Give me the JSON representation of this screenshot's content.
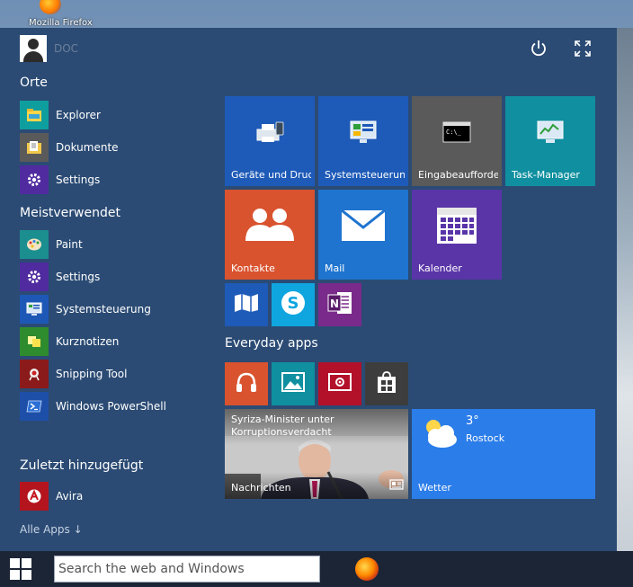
{
  "desktop": {
    "icon_label": "Mozilla Firefox"
  },
  "user": {
    "name": "DOC"
  },
  "sections": {
    "orte": "Orte",
    "meist": "Meistverwendet",
    "zuletzt": "Zuletzt hinzugefügt"
  },
  "orte_items": [
    {
      "label": "Explorer",
      "icon": "folder-icon",
      "color": "#0f9e9e"
    },
    {
      "label": "Dokumente",
      "icon": "document-icon",
      "color": "#5a5a5a"
    },
    {
      "label": "Settings",
      "icon": "gear-icon",
      "color": "#4f2b9f"
    }
  ],
  "meist_items": [
    {
      "label": "Paint",
      "icon": "palette-icon",
      "color": "#1b8f8f"
    },
    {
      "label": "Settings",
      "icon": "gear-icon",
      "color": "#4f2b9f"
    },
    {
      "label": "Systemsteuerung",
      "icon": "control-panel-icon",
      "color": "#1e58b6"
    },
    {
      "label": "Kurznotizen",
      "icon": "sticky-notes-icon",
      "color": "#2e8b2e"
    },
    {
      "label": "Snipping Tool",
      "icon": "scissors-icon",
      "color": "#8b1a1a"
    },
    {
      "label": "Windows PowerShell",
      "icon": "powershell-icon",
      "color": "#1e4fa8"
    }
  ],
  "zuletzt_items": [
    {
      "label": "Avira",
      "icon": "avira-icon",
      "color": "#b3141e"
    }
  ],
  "alle_apps": "Alle Apps ↓",
  "tiles": {
    "geraete": "Geräte und Druc",
    "systemsteuerung": "Systemsteuerun",
    "eingabe": "Eingabeaufforde",
    "taskmanager": "Task-Manager",
    "kontakte": "Kontakte",
    "mail": "Mail",
    "kalender": "Kalender",
    "nachrichten_headline": "Syriza-Minister unter Korruptionsverdacht",
    "nachrichten": "Nachrichten",
    "wetter_temp": "3°",
    "wetter_city": "Rostock",
    "wetter": "Wetter"
  },
  "everyday_apps": "Everyday apps",
  "search": {
    "placeholder": "Search the web and Windows"
  },
  "colors": {
    "menu_bg": "#2b4b74",
    "blue": "#1e5bb8",
    "gray": "#5a5a5a",
    "teal": "#0f8f9f",
    "orange": "#d9532f",
    "mail_blue": "#1f74cf",
    "purple": "#5a35a8",
    "weather_blue": "#2b7de9",
    "onenote": "#7a2a8a",
    "skype": "#0fa6e0",
    "store_gray": "#3d3d3d",
    "music_orange": "#d9532f",
    "photos_teal": "#0f8f9f",
    "video_red": "#b3102a"
  }
}
